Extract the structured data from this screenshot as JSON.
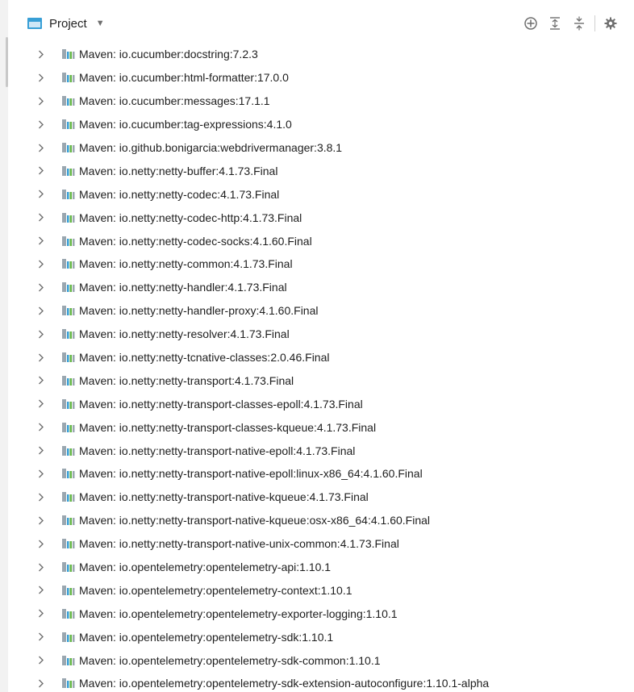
{
  "header": {
    "title": "Project",
    "dropdown_icon": "caret-down-icon",
    "tools": [
      "locate-icon",
      "expand-all-icon",
      "collapse-all-icon",
      "settings-gear-icon"
    ]
  },
  "colors": {
    "panel_bg": "#ffffff",
    "accent": "#389fd6",
    "text": "#1e1e1e",
    "icon_gray": "#6e6e6e"
  },
  "tree": {
    "items": [
      {
        "label": "Maven: io.cucumber:docstring:7.2.3"
      },
      {
        "label": "Maven: io.cucumber:html-formatter:17.0.0"
      },
      {
        "label": "Maven: io.cucumber:messages:17.1.1"
      },
      {
        "label": "Maven: io.cucumber:tag-expressions:4.1.0"
      },
      {
        "label": "Maven: io.github.bonigarcia:webdrivermanager:3.8.1"
      },
      {
        "label": "Maven: io.netty:netty-buffer:4.1.73.Final"
      },
      {
        "label": "Maven: io.netty:netty-codec:4.1.73.Final"
      },
      {
        "label": "Maven: io.netty:netty-codec-http:4.1.73.Final"
      },
      {
        "label": "Maven: io.netty:netty-codec-socks:4.1.60.Final"
      },
      {
        "label": "Maven: io.netty:netty-common:4.1.73.Final"
      },
      {
        "label": "Maven: io.netty:netty-handler:4.1.73.Final"
      },
      {
        "label": "Maven: io.netty:netty-handler-proxy:4.1.60.Final"
      },
      {
        "label": "Maven: io.netty:netty-resolver:4.1.73.Final"
      },
      {
        "label": "Maven: io.netty:netty-tcnative-classes:2.0.46.Final"
      },
      {
        "label": "Maven: io.netty:netty-transport:4.1.73.Final"
      },
      {
        "label": "Maven: io.netty:netty-transport-classes-epoll:4.1.73.Final"
      },
      {
        "label": "Maven: io.netty:netty-transport-classes-kqueue:4.1.73.Final"
      },
      {
        "label": "Maven: io.netty:netty-transport-native-epoll:4.1.73.Final"
      },
      {
        "label": "Maven: io.netty:netty-transport-native-epoll:linux-x86_64:4.1.60.Final"
      },
      {
        "label": "Maven: io.netty:netty-transport-native-kqueue:4.1.73.Final"
      },
      {
        "label": "Maven: io.netty:netty-transport-native-kqueue:osx-x86_64:4.1.60.Final"
      },
      {
        "label": "Maven: io.netty:netty-transport-native-unix-common:4.1.73.Final"
      },
      {
        "label": "Maven: io.opentelemetry:opentelemetry-api:1.10.1"
      },
      {
        "label": "Maven: io.opentelemetry:opentelemetry-context:1.10.1"
      },
      {
        "label": "Maven: io.opentelemetry:opentelemetry-exporter-logging:1.10.1"
      },
      {
        "label": "Maven: io.opentelemetry:opentelemetry-sdk:1.10.1"
      },
      {
        "label": "Maven: io.opentelemetry:opentelemetry-sdk-common:1.10.1"
      },
      {
        "label": "Maven: io.opentelemetry:opentelemetry-sdk-extension-autoconfigure:1.10.1-alpha"
      }
    ]
  }
}
